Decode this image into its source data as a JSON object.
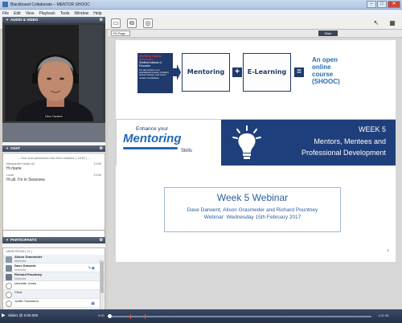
{
  "window": {
    "title": "Blackboard Collaborate – MENTOR SHOOC"
  },
  "menu": [
    "File",
    "Edit",
    "View",
    "Playback",
    "Tools",
    "Window",
    "Help"
  ],
  "left": {
    "av_header": "AUDIO & VIDEO",
    "video_name_label": "Dave Darwent",
    "chat_header": "CHAT",
    "chat_notice": "-- Your chat permission has been enabled. [ 18:51 ] --",
    "chat_messages": [
      {
        "sender": "Marguerite Kelpin #2",
        "time": "19:00",
        "text": "Hi marie"
      },
      {
        "sender": "Louie",
        "time": "19:00",
        "text": "Hi all. I'm in Swansea"
      }
    ],
    "participants_header": "PARTICIPANTS",
    "room_label": "MAIN ROOM  ( 11 )",
    "participants": [
      {
        "name": "Alison Grasmeder",
        "role": "Moderator",
        "bold": true
      },
      {
        "name": "Dave Darwent",
        "role": "Moderator",
        "bold": true
      },
      {
        "name": "Richard Pountney",
        "role": "Moderator",
        "bold": true
      },
      {
        "name": "charlotte Jones",
        "role": "",
        "bold": false
      },
      {
        "name": "Chris",
        "role": "",
        "bold": false
      },
      {
        "name": "Judith Townsend",
        "role": "",
        "bold": false
      }
    ]
  },
  "main": {
    "zoom": "Fit Page",
    "slide_tag": "Slide",
    "slide": {
      "logo_line1": "Sheffield Hallam University",
      "logo_line2": "Sheffield Institute of Education",
      "logo_desc": "For all mentors in an educational context, including school mentors, and senior mentor coordinators",
      "box1": "Mentoring",
      "plus": "+",
      "box2": "E-Learning",
      "equals": "=",
      "shooc_lines": [
        "An open",
        "online",
        "course",
        "(SHOOC)"
      ],
      "banner_enhance": "Enhance your",
      "banner_mentoring": "Mentoring",
      "banner_skills": "Skills",
      "banner_week": "WEEK 5",
      "banner_sub1": "Mentors, Mentees and",
      "banner_sub2": "Professional Development",
      "webinar_title": "Week 5 Webinar",
      "webinar_names": "Dave Darwent, Alison Grasmeder and Richard Pountney",
      "webinar_date": "Webinar: Wednesday 15th February 2017",
      "slide_number": "1"
    }
  },
  "bottom": {
    "status": "Slide1 @ 0:00.000",
    "time_start": "0:00",
    "time_end": "1:01:08"
  },
  "colors": {
    "navy": "#1e3f7b",
    "brand_blue": "#2468b0",
    "shu_red": "#e03a3e",
    "panel_header": "#3c4658"
  }
}
